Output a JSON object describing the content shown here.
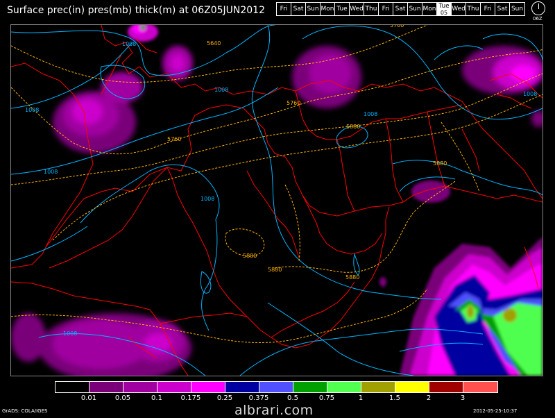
{
  "title": "Surface prec(in) pres(mb) thick(m) at 06Z05JUN2012",
  "days": [
    {
      "label": "Fri"
    },
    {
      "label": "Sat"
    },
    {
      "label": "Sun"
    },
    {
      "label": "Mon"
    },
    {
      "label": "Tue"
    },
    {
      "label": "Wed"
    },
    {
      "label": "Thu"
    },
    {
      "label": "Fri"
    },
    {
      "label": "Sat"
    },
    {
      "label": "Sun"
    },
    {
      "label": "Mon"
    },
    {
      "label": "Tue",
      "sub": "05",
      "active": true
    },
    {
      "label": "Wed"
    },
    {
      "label": "Thu"
    },
    {
      "label": "Fri"
    },
    {
      "label": "Sat"
    },
    {
      "label": "Sun"
    }
  ],
  "clock_label": "06Z",
  "map": {
    "pressure_color": "#00b4ff",
    "thickness_color": "#ffb400",
    "border_color": "#ff0000",
    "pressure_labels": [
      "1008",
      "1008",
      "1008",
      "1008",
      "1008",
      "1008",
      "1008",
      "1008"
    ],
    "thickness_labels": [
      "5760",
      "5640",
      "5760",
      "5760",
      "5880",
      "5880",
      "5880",
      "5880",
      "5880"
    ]
  },
  "colorbar": {
    "colors": [
      "#000000",
      "#7a007a",
      "#a000a0",
      "#cc00cc",
      "#ff00ff",
      "#0000a0",
      "#5050ff",
      "#00a000",
      "#50ff50",
      "#a0a000",
      "#ffff00",
      "#a00000",
      "#ff5050"
    ],
    "labels": [
      "0.01",
      "0.05",
      "0.1",
      "0.175",
      "0.25",
      "0.375",
      "0.5",
      "0.75",
      "1",
      "1.5",
      "2",
      "3"
    ]
  },
  "footer_left": "GrADS: COLA/IGES",
  "footer_right": "2012-05-25-10:37",
  "watermark": "albrari.com"
}
